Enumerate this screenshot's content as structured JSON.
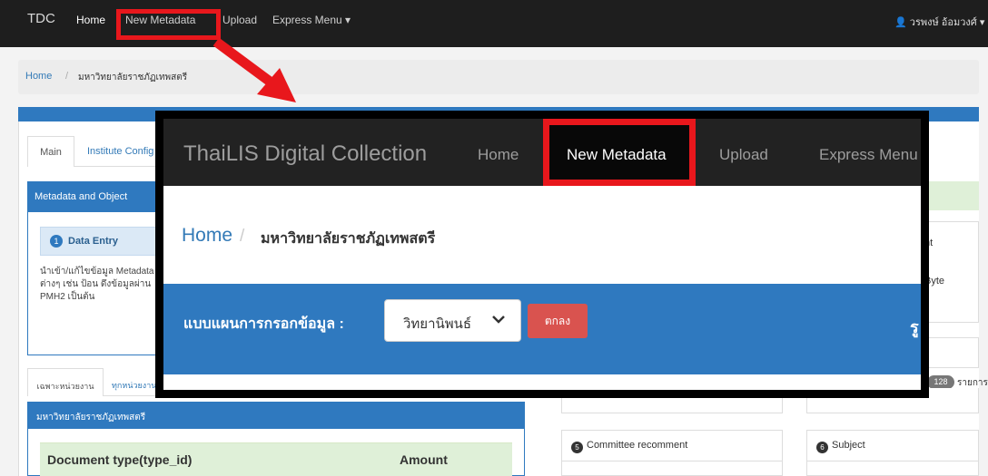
{
  "background": {
    "navbar": {
      "brand": "TDC",
      "items": [
        "Home",
        "New Metadata",
        "Upload",
        "Express Menu ▾"
      ],
      "user": "วรพงษ์ อ้อมวงศ์ ▾"
    },
    "breadcrumb": {
      "home": "Home",
      "separator": "/",
      "current": "มหาวิทยาลัยราชภัฏเทพสตรี"
    },
    "tabs": {
      "main": "Main",
      "institute": "Institute Config"
    },
    "metadata_panel": {
      "title": "Metadata and Object",
      "data_entry_number": "1",
      "data_entry": "Data Entry",
      "description": "นำเข้า/แก้ไขข้อมูล Metadata ต่างๆ เช่น ป้อน ดึงข้อมูลผ่าน PMH2 เป็นต้น"
    },
    "tabs2": {
      "a": "เฉพาะหน่วยงาน",
      "b": "ทุกหน่วยงาน"
    },
    "org_panel": {
      "title": "มหาวิทยาลัยราชภัฏเทพสตรี",
      "col_type": "Document type(type_id)",
      "col_amount": "Amount"
    },
    "right": {
      "nt_text": "nt",
      "byte_text": "Byte",
      "badge": "128",
      "rayakan": "รายการ"
    },
    "cards": [
      {
        "num": "5",
        "title": "Committee recomment"
      },
      {
        "num": "6",
        "title": "Subject"
      }
    ]
  },
  "zoom": {
    "brand": "ThaiLIS Digital Collection",
    "nav": {
      "home": "Home",
      "new_metadata": "New Metadata",
      "upload": "Upload",
      "express": "Express Menu"
    },
    "breadcrumb": {
      "home": "Home",
      "separator": "/",
      "current": "มหาวิทยาลัยราชภัฏเทพสตรี"
    },
    "form": {
      "label": "แบบแผนการกรอกข้อมูล :",
      "select_value": "วิทยานิพนธ์",
      "ok_button": "ตกลง",
      "right_fragment": "รู"
    }
  },
  "colors": {
    "highlight": "#e8171c",
    "primary": "#2f79bf",
    "navbar": "#222222",
    "danger": "#d9534f"
  }
}
